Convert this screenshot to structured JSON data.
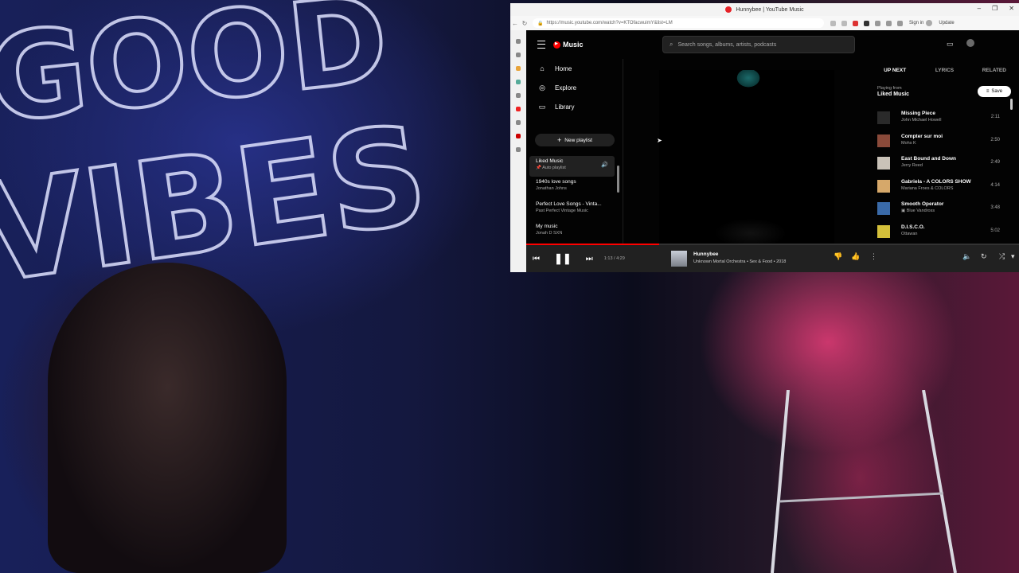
{
  "browser": {
    "tab_title": "Hunnybee | YouTube Music",
    "url": "https://music.youtube.com/watch?v=KTOfacwuimY&list=LM",
    "sign_in": "Sign in",
    "update": "Update",
    "window_controls": [
      "–",
      "❐",
      "✕"
    ]
  },
  "ytm": {
    "logo_text": "Music",
    "search_placeholder": "Search songs, albums, artists, podcasts",
    "nav": [
      {
        "label": "Home",
        "icon": "home-icon"
      },
      {
        "label": "Explore",
        "icon": "compass-icon"
      },
      {
        "label": "Library",
        "icon": "library-icon"
      }
    ],
    "new_playlist": "New playlist",
    "playlists": [
      {
        "title": "Liked Music",
        "subtitle": "Auto playlist",
        "active": true
      },
      {
        "title": "1940s love songs",
        "subtitle": "Jonathan Johns"
      },
      {
        "title": "Perfect Love Songs - Vinta...",
        "subtitle": "Past Perfect Vintage Music"
      },
      {
        "title": "My music",
        "subtitle": "Jonah D SXN"
      }
    ],
    "panel": {
      "tabs": [
        "UP NEXT",
        "LYRICS",
        "RELATED"
      ],
      "playing_from_label": "Playing from",
      "playing_from": "Liked Music",
      "save_label": "Save",
      "queue": [
        {
          "title": "Missing Piece",
          "artist": "John Michael Howell",
          "duration": "2:11",
          "color": "#2a2a2a"
        },
        {
          "title": "Compter sur moi",
          "artist": "Mohs K",
          "duration": "2:50",
          "color": "#8a4a3a"
        },
        {
          "title": "East Bound and Down",
          "artist": "Jerry Reed",
          "duration": "2:49",
          "color": "#c9c2b8"
        },
        {
          "title": "Gabriela - A COLORS SHOW",
          "artist": "Mariana Froes & COLORS",
          "duration": "4:14",
          "color": "#d6a86a"
        },
        {
          "title": "Smooth Operator",
          "artist": "Blue Vandross",
          "duration": "3:48",
          "color": "#3a6aa8"
        },
        {
          "title": "D.I.S.C.O.",
          "artist": "Ottawan",
          "duration": "5:02",
          "color": "#d4c03a"
        }
      ]
    },
    "player": {
      "time": "1:13 / 4:29",
      "progress": 0.27,
      "song_title": "Hunnybee",
      "song_sub": "Unknown Mortal Orchestra • Sex & Food • 2018"
    }
  },
  "webcam": {
    "neon_line1": "GOOD",
    "neon_line2": "VIBES"
  }
}
